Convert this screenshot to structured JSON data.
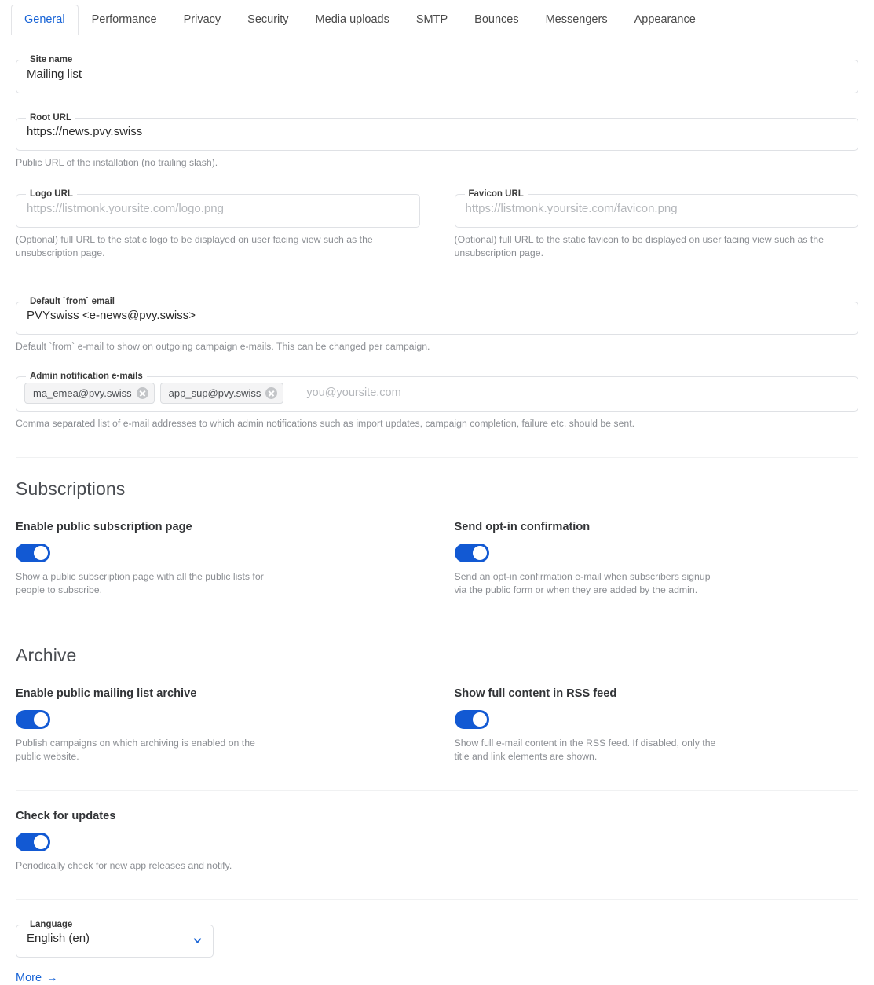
{
  "tabs": [
    {
      "label": "General",
      "active": true
    },
    {
      "label": "Performance",
      "active": false
    },
    {
      "label": "Privacy",
      "active": false
    },
    {
      "label": "Security",
      "active": false
    },
    {
      "label": "Media uploads",
      "active": false
    },
    {
      "label": "SMTP",
      "active": false
    },
    {
      "label": "Bounces",
      "active": false
    },
    {
      "label": "Messengers",
      "active": false
    },
    {
      "label": "Appearance",
      "active": false
    }
  ],
  "colors": {
    "accent": "#1763d6",
    "toggle_on": "#1259d3",
    "border": "#dfe1e5",
    "help_text": "#8b8e93"
  },
  "fields": {
    "site_name": {
      "label": "Site name",
      "value": "Mailing list",
      "placeholder": ""
    },
    "root_url": {
      "label": "Root URL",
      "value": "https://news.pvy.swiss",
      "placeholder": "",
      "help": "Public URL of the installation (no trailing slash)."
    },
    "logo_url": {
      "label": "Logo URL",
      "value": "",
      "placeholder": "https://listmonk.yoursite.com/logo.png",
      "help": "(Optional) full URL to the static logo to be displayed on user facing view such as the unsubscription page."
    },
    "favicon_url": {
      "label": "Favicon URL",
      "value": "",
      "placeholder": "https://listmonk.yoursite.com/favicon.png",
      "help": "(Optional) full URL to the static favicon to be displayed on user facing view such as the unsubscription page."
    },
    "from_email": {
      "label": "Default `from` email",
      "value": "PVYswiss <e-news@pvy.swiss>",
      "placeholder": "",
      "help": "Default `from` e-mail to show on outgoing campaign e-mails. This can be changed per campaign."
    },
    "admin_emails": {
      "label": "Admin notification e-mails",
      "chips": [
        {
          "text": "ma_emea@pvy.swiss",
          "remove_icon": "close-circle-icon"
        },
        {
          "text": "app_sup@pvy.swiss",
          "remove_icon": "close-circle-icon"
        }
      ],
      "placeholder": "you@yoursite.com",
      "help": "Comma separated list of e-mail addresses to which admin notifications such as import updates, campaign completion, failure etc. should be sent."
    },
    "language": {
      "label": "Language",
      "value": "English (en)",
      "chevron_icon": "chevron-down-icon",
      "options": [
        "English (en)"
      ]
    }
  },
  "sections": {
    "subscriptions": {
      "title": "Subscriptions",
      "toggles": [
        {
          "label": "Enable public subscription page",
          "state": "on",
          "help": "Show a public subscription page with all the public lists for people to subscribe."
        },
        {
          "label": "Send opt-in confirmation",
          "state": "on",
          "help": "Send an opt-in confirmation e-mail when subscribers signup via the public form or when they are added by the admin."
        }
      ]
    },
    "archive": {
      "title": "Archive",
      "toggles": [
        {
          "label": "Enable public mailing list archive",
          "state": "on",
          "help": "Publish campaigns on which archiving is enabled on the public website."
        },
        {
          "label": "Show full content in RSS feed",
          "state": "on",
          "help": "Show full e-mail content in the RSS feed. If disabled, only the title and link elements are shown."
        }
      ]
    },
    "updates": {
      "toggle": {
        "label": "Check for updates",
        "state": "on",
        "help": "Periodically check for new app releases and notify."
      }
    }
  },
  "more_link": {
    "label": "More",
    "arrow": "→"
  }
}
